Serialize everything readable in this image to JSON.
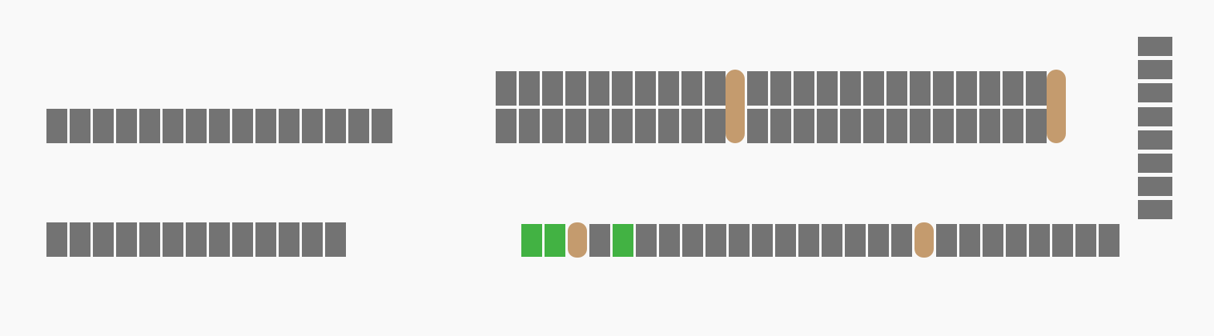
{
  "colors": {
    "background": "#f9f9f9",
    "occupied": "#737373",
    "selected": "#42b243",
    "table": "#c49b6e"
  },
  "legend_states": [
    "occupied",
    "selected",
    "table"
  ],
  "blocks": [
    {
      "id": "left-upper-row",
      "rows": [
        {
          "cells": [
            "occupied",
            "occupied",
            "occupied",
            "occupied",
            "occupied",
            "occupied",
            "occupied",
            "occupied",
            "occupied",
            "occupied",
            "occupied",
            "occupied",
            "occupied",
            "occupied",
            "occupied"
          ]
        }
      ]
    },
    {
      "id": "left-lower-row",
      "rows": [
        {
          "cells": [
            "occupied",
            "occupied",
            "occupied",
            "occupied",
            "occupied",
            "occupied",
            "occupied",
            "occupied",
            "occupied",
            "occupied",
            "occupied",
            "occupied",
            "occupied"
          ]
        }
      ]
    },
    {
      "id": "center-double-row",
      "rows": [
        {
          "cells": [
            "occupied",
            "occupied",
            "occupied",
            "occupied",
            "occupied",
            "occupied",
            "occupied",
            "occupied",
            "occupied",
            "occupied",
            "occupied",
            "occupied",
            "occupied",
            "occupied",
            "occupied",
            "occupied",
            "occupied",
            "occupied",
            "occupied",
            "occupied",
            "occupied",
            "occupied",
            "occupied",
            "occupied"
          ]
        },
        {
          "cells": [
            "occupied",
            "occupied",
            "occupied",
            "occupied",
            "occupied",
            "occupied",
            "occupied",
            "occupied",
            "occupied",
            "occupied",
            "occupied",
            "occupied",
            "occupied",
            "occupied",
            "occupied",
            "occupied",
            "occupied",
            "occupied",
            "occupied",
            "occupied",
            "occupied",
            "occupied",
            "occupied",
            "occupied"
          ]
        }
      ],
      "tables": [
        {
          "after_index": 9
        },
        {
          "after_index": 24
        }
      ]
    },
    {
      "id": "bottom-right-row",
      "rows": [
        {
          "cells": [
            "selected",
            "selected",
            "table",
            "occupied",
            "selected",
            "occupied",
            "occupied",
            "occupied",
            "occupied",
            "occupied",
            "occupied",
            "occupied",
            "occupied",
            "occupied",
            "occupied",
            "occupied",
            "occupied",
            "table",
            "occupied",
            "occupied",
            "occupied",
            "occupied",
            "occupied",
            "occupied",
            "occupied",
            "occupied"
          ]
        }
      ]
    },
    {
      "id": "right-column",
      "cells": [
        "occupied",
        "occupied",
        "occupied",
        "occupied",
        "occupied",
        "occupied",
        "occupied",
        "occupied"
      ]
    }
  ]
}
